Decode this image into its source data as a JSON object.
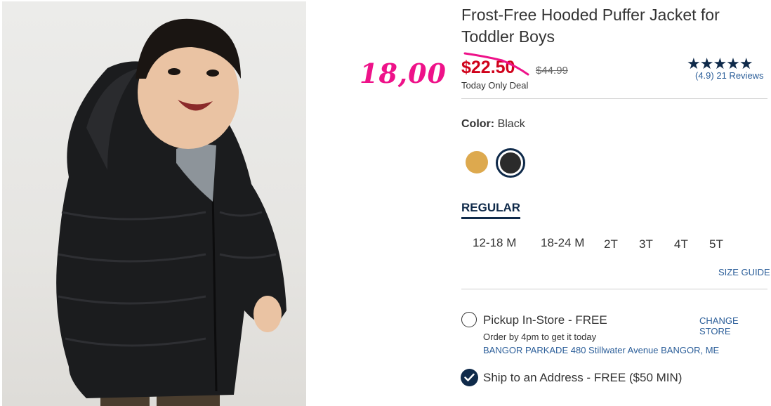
{
  "annotation": "18,00",
  "product": {
    "title": "Frost-Free Hooded Puffer Jacket for Toddler Boys",
    "sale_price": "$22.50",
    "original_price": "$44.99",
    "deal_text": "Today Only Deal",
    "rating_stars": "★★★★★",
    "rating_value": "(4.9)",
    "review_count": "21 Reviews"
  },
  "color": {
    "label": "Color:",
    "selected": "Black",
    "swatches": [
      {
        "name": "gold",
        "hex": "#dda94e"
      },
      {
        "name": "black",
        "hex": "#2b2b2b",
        "selected": true
      }
    ]
  },
  "fit_tab": "REGULAR",
  "sizes": [
    "12-18 M",
    "18-24 M",
    "2T",
    "3T",
    "4T",
    "5T"
  ],
  "size_guide": "SIZE GUIDE",
  "pickup": {
    "label": "Pickup In-Store - FREE",
    "change_store": "CHANGE STORE",
    "order_by": "Order by 4pm to get it today",
    "store": "BANGOR PARKADE 480 Stillwater Avenue  BANGOR, ME"
  },
  "ship": {
    "label": "Ship to an Address - FREE ($50 MIN)"
  },
  "colors": {
    "sale_red": "#d0021b",
    "brand_navy": "#0f2a4a",
    "link_blue": "#2b5e99",
    "annotation_pink": "#ee1289"
  }
}
